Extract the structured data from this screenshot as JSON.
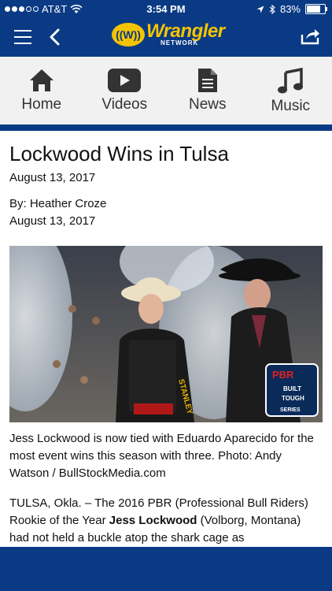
{
  "status_bar": {
    "carrier": "AT&T",
    "time": "3:54 PM",
    "battery": "83%",
    "battery_level": 0.83
  },
  "header": {
    "logo_badge": "((W))",
    "logo_word": "Wrangler",
    "logo_sub": "NETWORK"
  },
  "tabs": [
    {
      "label": "Home",
      "icon": "home-icon"
    },
    {
      "label": "Videos",
      "icon": "play-icon"
    },
    {
      "label": "News",
      "icon": "document-icon"
    },
    {
      "label": "Music",
      "icon": "music-note-icon"
    }
  ],
  "article": {
    "title": "Lockwood Wins in Tulsa",
    "date": "August 13, 2017",
    "byline": "By: Heather Croze",
    "byline_date": "August 13, 2017",
    "photo_badge_1": "PBR",
    "photo_badge_2": "BUILT",
    "photo_badge_3": "TOUGH",
    "photo_badge_4": "SERIES",
    "caption": "Jess Lockwood is now tied with Eduardo Aparecido for the most event wins this season with three. Photo: Andy Watson / BullStockMedia.com",
    "body_pre": "TULSA, Okla. – The 2016 PBR (Professional Bull Riders) Rookie of the Year ",
    "body_bold": "Jess Lockwood",
    "body_post": " (Volborg, Montana) had not held a buckle atop the shark cage as"
  },
  "colors": {
    "brand_blue": "#0a3a84",
    "brand_yellow": "#f5c400"
  }
}
